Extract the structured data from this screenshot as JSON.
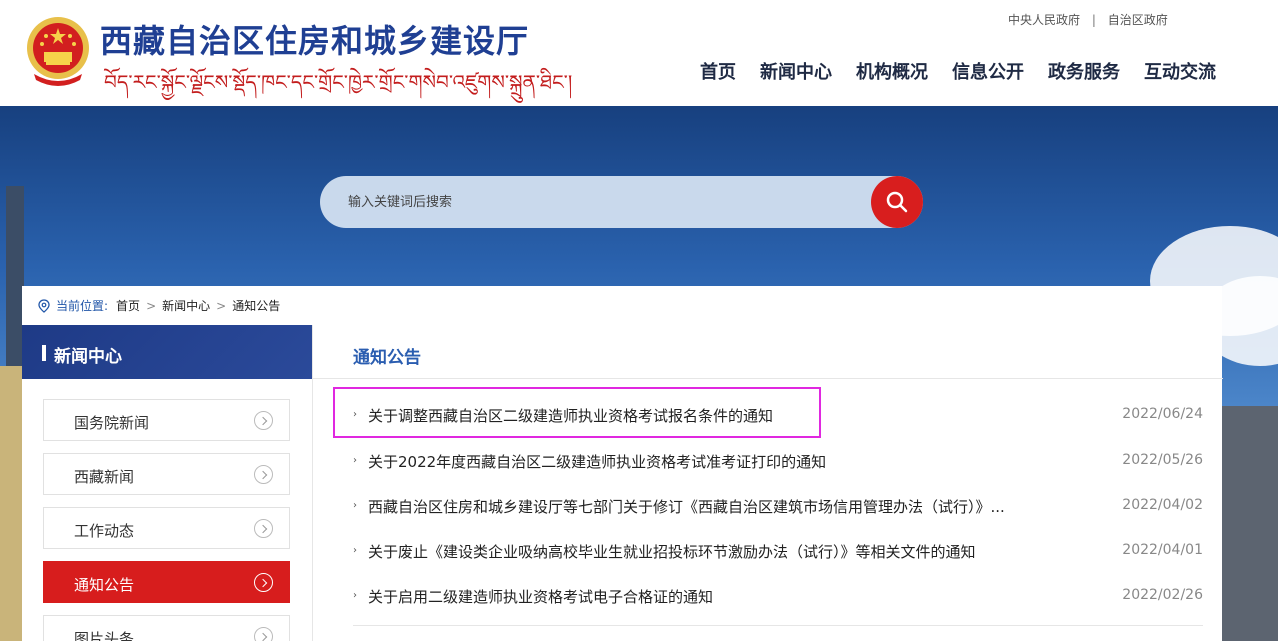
{
  "header": {
    "site_title": "西藏自治区住房和城乡建设厅",
    "tibetan_title": "བོད་རང་སྐྱོང་ལྗོངས་སྡོད་ཁང་དང་གྲོང་ཁྱེར་གྲོང་གསེབ་འཛུགས་སྐྲུན་ཐིང་།",
    "top_links": [
      "中央人民政府",
      "自治区政府"
    ],
    "top_sep": "|",
    "nav": [
      "首页",
      "新闻中心",
      "机构概况",
      "信息公开",
      "政务服务",
      "互动交流"
    ],
    "colors": {
      "title": "#1f3f93",
      "tibetan": "#c31d1d"
    }
  },
  "search": {
    "placeholder": "输入关键词后搜索",
    "button_icon": "search-icon"
  },
  "breadcrumb": {
    "label": "当前位置:",
    "items": [
      "首页",
      "新闻中心",
      "通知公告"
    ],
    "arrow": ">"
  },
  "sidebar": {
    "title": "新闻中心",
    "items": [
      {
        "label": "国务院新闻",
        "active": false
      },
      {
        "label": "西藏新闻",
        "active": false
      },
      {
        "label": "工作动态",
        "active": false
      },
      {
        "label": "通知公告",
        "active": true
      },
      {
        "label": "图片头条",
        "active": false
      }
    ],
    "active_color": "#d71d1d"
  },
  "main": {
    "title": "通知公告",
    "bullet": "›",
    "news": [
      {
        "title": "关于调整西藏自治区二级建造师执业资格考试报名条件的通知",
        "date": "2022/06/24"
      },
      {
        "title": "关于2022年度西藏自治区二级建造师执业资格考试准考证打印的通知",
        "date": "2022/05/26"
      },
      {
        "title": "西藏自治区住房和城乡建设厅等七部门关于修订《西藏自治区建筑市场信用管理办法（试行）》...",
        "date": "2022/04/02"
      },
      {
        "title": "关于废止《建设类企业吸纳高校毕业生就业招投标环节激励办法（试行）》等相关文件的通知",
        "date": "2022/04/01"
      },
      {
        "title": "关于启用二级建造师执业资格考试电子合格证的通知",
        "date": "2022/02/26"
      }
    ]
  }
}
